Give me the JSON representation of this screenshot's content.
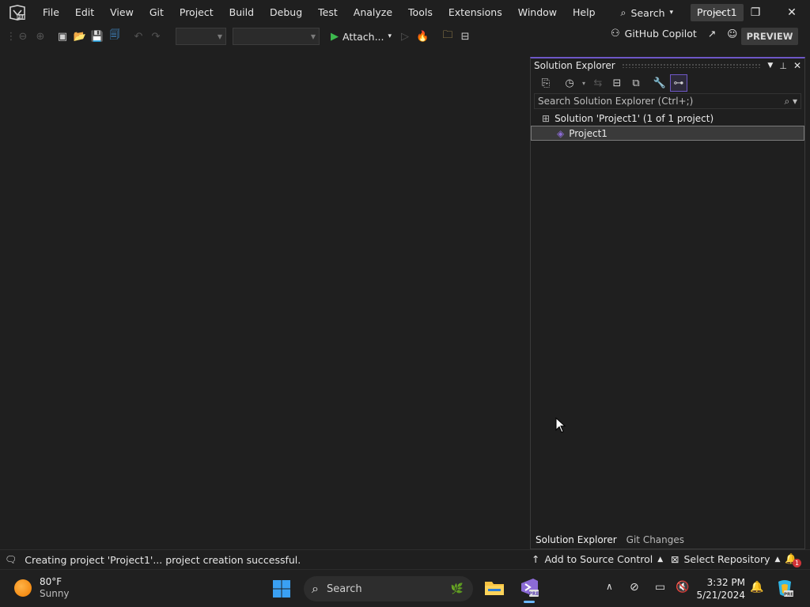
{
  "menu": {
    "items": [
      "File",
      "Edit",
      "View",
      "Git",
      "Project",
      "Build",
      "Debug",
      "Test",
      "Analyze",
      "Tools",
      "Extensions",
      "Window",
      "Help"
    ],
    "search_label": "Search",
    "project_name": "Project1"
  },
  "toolbar": {
    "attach_label": "Attach...",
    "copilot_label": "GitHub Copilot",
    "preview_label": "PREVIEW"
  },
  "solution_explorer": {
    "title": "Solution Explorer",
    "search_placeholder": "Search Solution Explorer (Ctrl+;)",
    "solution_label": "Solution 'Project1' (1 of 1 project)",
    "project_label": "Project1",
    "tabs": [
      "Solution Explorer",
      "Git Changes"
    ]
  },
  "statusbar": {
    "message": "Creating project 'Project1'... project creation successful.",
    "add_source_control": "Add to Source Control",
    "select_repository": "Select Repository",
    "notification_count": "1"
  },
  "taskbar": {
    "temperature": "80°F",
    "condition": "Sunny",
    "search_label": "Search",
    "time": "3:32 PM",
    "date": "5/21/2024"
  },
  "colors": {
    "accent": "#6e57c7",
    "vs_purple": "#8c6bd6",
    "play_green": "#3dba4e"
  }
}
